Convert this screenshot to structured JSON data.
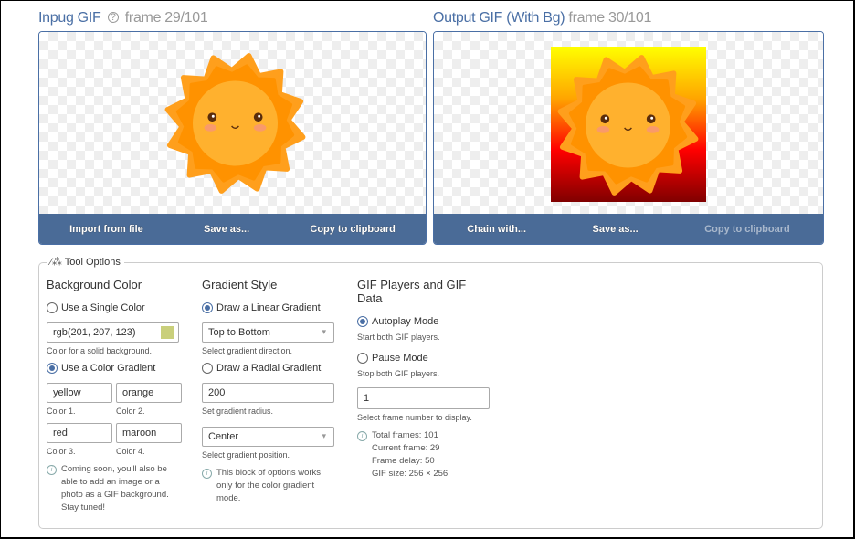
{
  "input": {
    "title": "Inpug GIF",
    "help_icon": "question-circle-icon",
    "frame_label": "frame 29/101",
    "buttons": [
      "Import from file",
      "Save as...",
      "Copy to clipboard"
    ]
  },
  "output": {
    "title": "Output GIF (With Bg)",
    "frame_label": "frame 30/101",
    "buttons": [
      "Chain with...",
      "Save as...",
      "Copy to clipboard"
    ],
    "gradient_colors": [
      "#ffff00",
      "#ffa500",
      "#ff0000",
      "#800000"
    ]
  },
  "tool_options": {
    "legend": "Tool Options",
    "legend_icon": "magic-wand-icon",
    "background": {
      "heading": "Background Color",
      "single_label": "Use a Single Color",
      "single_checked": false,
      "single_value": "rgb(201, 207, 123)",
      "swatch_color": "#c9cf7b",
      "single_hint": "Color for a solid background.",
      "gradient_label": "Use a Color Gradient",
      "gradient_checked": true,
      "colors": [
        {
          "value": "yellow",
          "hint": "Color 1."
        },
        {
          "value": "orange",
          "hint": "Color 2."
        },
        {
          "value": "red",
          "hint": "Color 3."
        },
        {
          "value": "maroon",
          "hint": "Color 4."
        }
      ],
      "info": "Coming soon, you'll also be able to add an image or a photo as a GIF background. Stay tuned!"
    },
    "gradient": {
      "heading": "Gradient Style",
      "linear_label": "Draw a Linear Gradient",
      "linear_checked": true,
      "direction": "Top to Bottom",
      "direction_hint": "Select gradient direction.",
      "radial_label": "Draw a Radial Gradient",
      "radial_checked": false,
      "radius": "200",
      "radius_hint": "Set gradient radius.",
      "position": "Center",
      "position_hint": "Select gradient position.",
      "info": "This block of options works only for the color gradient mode."
    },
    "players": {
      "heading": "GIF Players and GIF Data",
      "autoplay_label": "Autoplay Mode",
      "autoplay_checked": true,
      "autoplay_hint": "Start both GIF players.",
      "pause_label": "Pause Mode",
      "pause_checked": false,
      "pause_hint": "Stop both GIF players.",
      "frame_value": "1",
      "frame_hint": "Select frame number to display.",
      "stats": [
        "Total frames: 101",
        "Current frame: 29",
        "Frame delay: 50",
        "GIF size: 256 × 256"
      ]
    }
  }
}
